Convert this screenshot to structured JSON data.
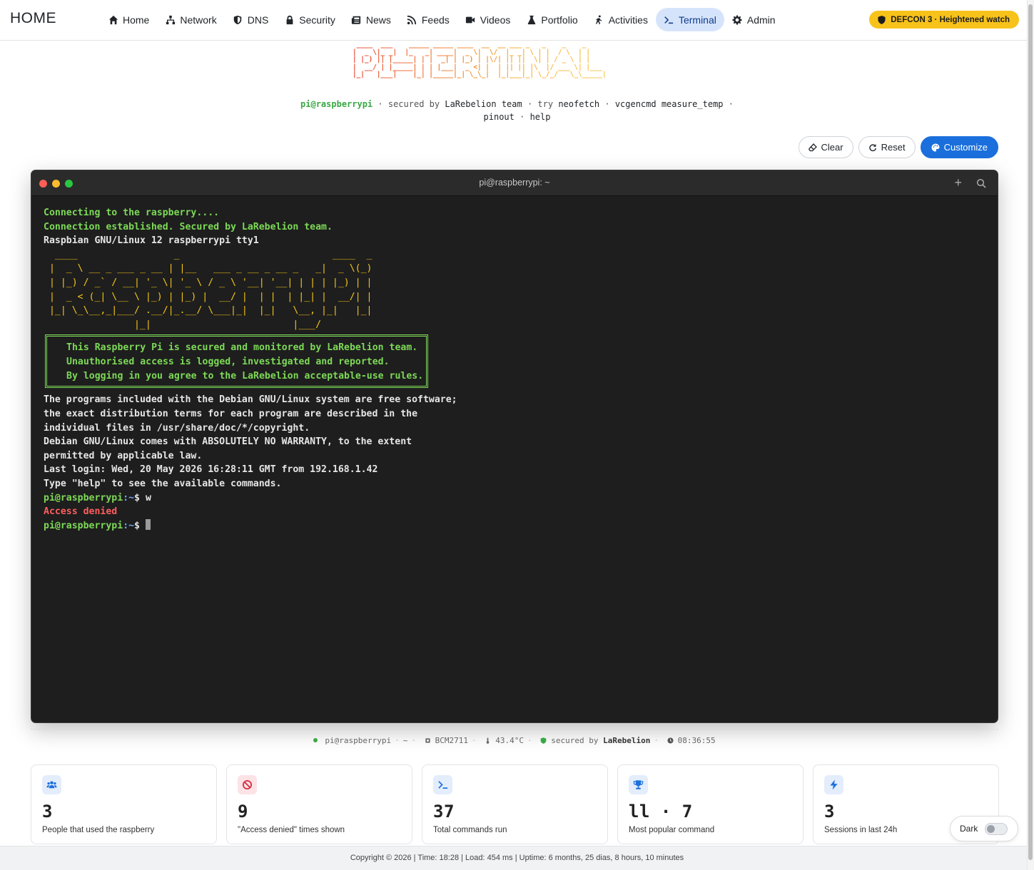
{
  "brand": "HOME",
  "nav": {
    "items": [
      {
        "label": "Home",
        "icon": "home-icon"
      },
      {
        "label": "Network",
        "icon": "network-icon"
      },
      {
        "label": "DNS",
        "icon": "shield-icon"
      },
      {
        "label": "Security",
        "icon": "lock-icon"
      },
      {
        "label": "News",
        "icon": "newspaper-icon"
      },
      {
        "label": "Feeds",
        "icon": "rss-icon"
      },
      {
        "label": "Videos",
        "icon": "video-icon"
      },
      {
        "label": "Portfolio",
        "icon": "flask-icon"
      },
      {
        "label": "Activities",
        "icon": "running-icon"
      },
      {
        "label": "Terminal",
        "icon": "terminal-icon",
        "active": true
      },
      {
        "label": "Admin",
        "icon": "gear-icon"
      }
    ],
    "defcon": "DEFCON 3 · Heightened watch"
  },
  "header": {
    "ascii": " ____  ___    _____ _____ ____  __  __ ___ _   _    _    _     \n|  _ \\|_ _|  |_   _| ____|  _ \\|  \\/  |_ _| \\ | |  / \\  | |    \n| |_) || |_____| | |  _| | |_) | |\\/| || ||  \\| | / _ \\ | |    \n|  __/ | |_____| | | |___|  _ <| |  | || || |\\  |/ ___ \\| |___ \n|_|   |___|    |_| |_____|_| \\_\\_|  |_|___|_| \\_/_/   \\_\\_____|",
    "user": "pi@raspberrypi",
    "secured_by": "secured by",
    "team": "LaRebelion team",
    "try": "try",
    "cmd1": "neofetch",
    "cmd2": "vcgencmd measure_temp",
    "cmd3": "pinout",
    "cmd4": "help"
  },
  "actions": {
    "clear": "Clear",
    "reset": "Reset",
    "customize": "Customize"
  },
  "terminal": {
    "title": "pi@raspberrypi: ~",
    "line1": "Connecting to the raspberry....",
    "line2": "Connection established. Secured by LaRebelion team.",
    "line3": "Raspbian GNU/Linux 12 raspberrypi tty1",
    "ascii_logo": "  ____                 _                           ____  _ \n |  _ \\ __ _ ___ _ __ | |__   ___ _ __ _ __ _   _|  _ \\(_)\n | |_) / _` / __| '_ \\| '_ \\ / _ \\ '__| '__| | | | |_) | |\n |  _ < (_| \\__ \\ |_) | |_) |  __/ |  | |  | |_| |  __/| |\n |_| \\_\\__,_|___/ .__/|_.__/ \\___|_|  |_|   \\__, |_|   |_|\n                |_|                         |___/          ",
    "banner1": "This Raspberry Pi is secured and monitored by LaRebelion team.",
    "banner2": "Unauthorised access is logged, investigated and reported.",
    "banner3": "By logging in you agree to the LaRebelion acceptable-use rules.",
    "info1": "The programs included with the Debian GNU/Linux system are free software;",
    "info2": "the exact distribution terms for each program are described in the",
    "info3": "individual files in /usr/share/doc/*/copyright.",
    "info4": "Debian GNU/Linux comes with ABSOLUTELY NO WARRANTY, to the extent",
    "info5": "permitted by applicable law.",
    "lastlogin": "Last login: Wed, 20 May 2026 16:28:11 GMT from 192.168.1.42",
    "helphint": "Type \"help\" to see the available commands.",
    "prompt_user": "pi@raspberrypi",
    "prompt_path": ":~",
    "prompt_sign": "$ ",
    "cmd": "w",
    "error": "Access denied"
  },
  "status": {
    "user": "pi@raspberrypi",
    "path": "~",
    "chip": "BCM2711",
    "temp": "43.4°C",
    "secured": "secured by",
    "team": "LaRebelion",
    "time": "08:36:55"
  },
  "cards": [
    {
      "value": "3",
      "label": "People that used the raspberry",
      "icon": "users-icon",
      "color": "#1a6fdc",
      "bg": "#e3edfc"
    },
    {
      "value": "9",
      "label": "\"Access denied\" times shown",
      "icon": "ban-icon",
      "color": "#d63447",
      "bg": "#fde3e6"
    },
    {
      "value": "37",
      "label": "Total commands run",
      "icon": "terminal-icon",
      "color": "#1a6fdc",
      "bg": "#e3edfc"
    },
    {
      "value": "ll · 7",
      "label": "Most popular command",
      "icon": "trophy-icon",
      "color": "#1a6fdc",
      "bg": "#e3edfc"
    },
    {
      "value": "3",
      "label": "Sessions in last 24h",
      "icon": "bolt-icon",
      "color": "#1a6fdc",
      "bg": "#e3edfc"
    }
  ],
  "toggle": {
    "label": "Dark"
  },
  "footer": "Copyright © 2026 | Time: 18:28 | Load: 454 ms | Uptime: 6 months, 25 dias, 8 hours, 10 minutes"
}
